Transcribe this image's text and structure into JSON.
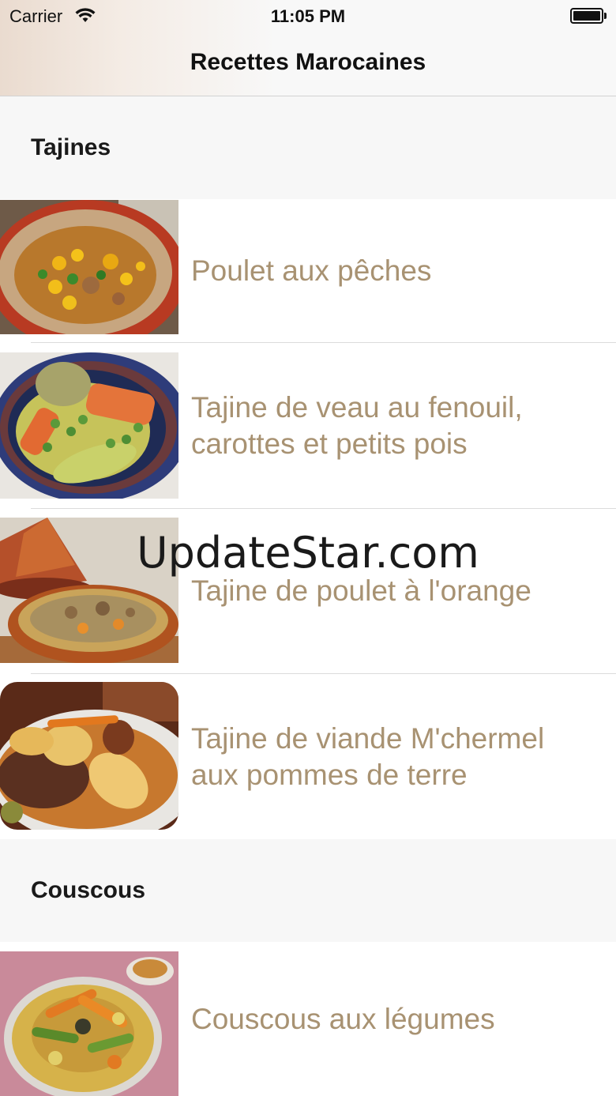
{
  "status_bar": {
    "carrier": "Carrier",
    "time": "11:05 PM"
  },
  "nav": {
    "title": "Recettes Marocaines"
  },
  "sections": [
    {
      "title": "Tajines",
      "items": [
        {
          "title": "Poulet aux pêches"
        },
        {
          "title": "Tajine de veau au fenouil, carottes et petits pois"
        },
        {
          "title": "Tajine de poulet à l'orange"
        },
        {
          "title": "Tajine de viande M'chermel aux pommes de terre"
        }
      ]
    },
    {
      "title": "Couscous",
      "items": [
        {
          "title": "Couscous aux légumes"
        }
      ]
    }
  ],
  "watermark": "UpdateStar.com",
  "colors": {
    "item_text": "#a89272",
    "section_bg": "#f7f7f7"
  }
}
